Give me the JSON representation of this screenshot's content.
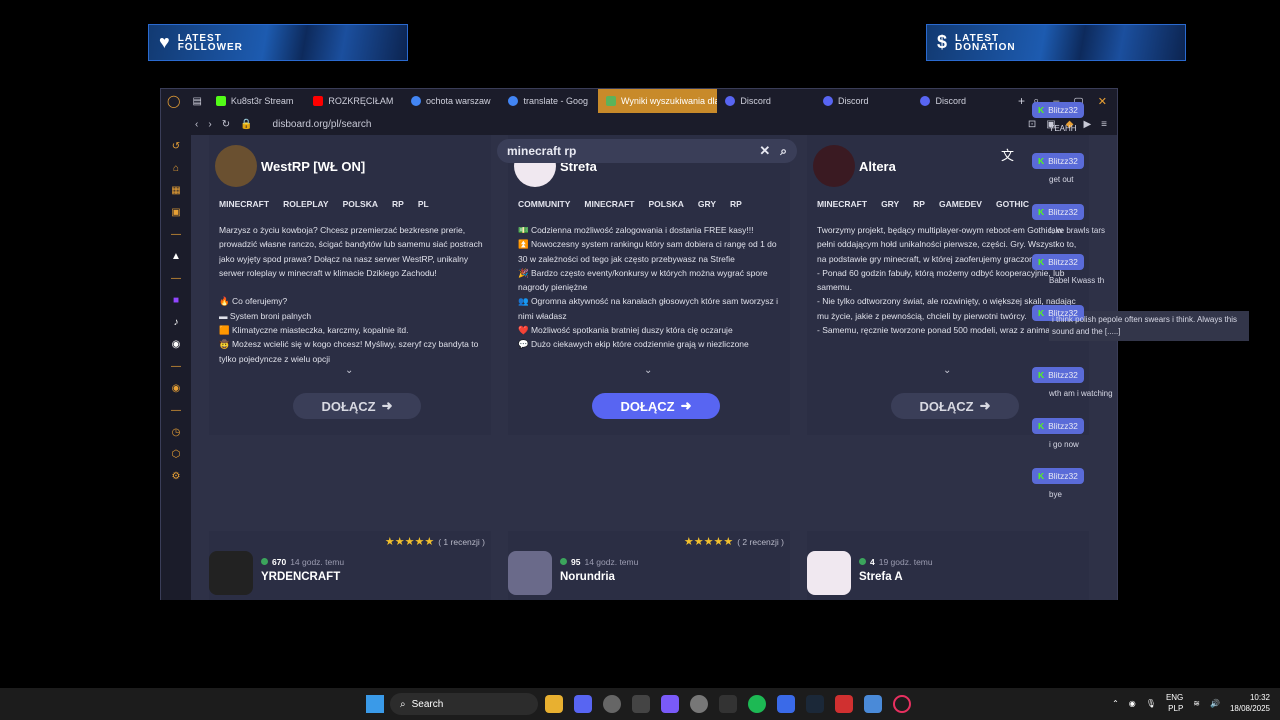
{
  "overlay": {
    "follower": {
      "line1": "LATEST",
      "line2": "FOLLOWER"
    },
    "donation": {
      "line1": "LATEST",
      "line2": "DONATION"
    }
  },
  "tabs": [
    {
      "label": "Ku8st3r Stream",
      "color": "#53fc18"
    },
    {
      "label": "ROZKRĘCIŁAM",
      "color": "#ff0000"
    },
    {
      "label": "ochota warszaw",
      "color": "#4285f4"
    },
    {
      "label": "translate - Goog",
      "color": "#4285f4"
    },
    {
      "label": "Wyniki wyszukiwania dla",
      "color": "#f0a030",
      "active": true
    },
    {
      "label": "Discord",
      "color": "#5865f2"
    },
    {
      "label": "Discord",
      "color": "#5865f2"
    },
    {
      "label": "Discord",
      "color": "#5865f2"
    }
  ],
  "address": {
    "url": "disboard.org/pl/search"
  },
  "search": {
    "query": "minecraft rp"
  },
  "servers": [
    {
      "name": "WestRP [WŁ ON]",
      "tags": [
        "MINECRAFT",
        "ROLEPLAY",
        "POLSKA",
        "RP",
        "PL"
      ],
      "desc": "Marzysz o życiu kowboja? Chcesz przemierzać bezkresne prerie, prowadzić własne ranczo, ścigać bandytów lub samemu siać postrach jako wyjęty spod prawa? Dołącz na nasz serwer WestRP, unikalny serwer roleplay w minecraft w klimacie Dzikiego Zachodu!\n\n🔥 Co oferujemy?\n▬ System broni palnych\n🟧 Klimatyczne miasteczka, karczmy, kopalnie itd.\n🤠 Możesz wcielić się w kogo chcesz! Myśliwy, szeryf czy bandyta to tylko pojedyncze z wielu opcji",
      "join": "DOŁĄCZ"
    },
    {
      "name": "Strefa",
      "tags": [
        "COMMUNITY",
        "MINECRAFT",
        "POLSKA",
        "GRY",
        "RP"
      ],
      "desc": "💵 Codzienna możliwość zalogowania i dostania FREE kasy!!!\n⏫ Nowoczesny system rankingu który sam dobiera ci rangę od 1 do 30 w zależności od tego jak często przebywasz na Strefie\n🎉 Bardzo często eventy/konkursy w których można wygrać spore nagrody pieniężne\n👥 Ogromna aktywność na kanałach głosowych które sam tworzysz i nimi władasz\n❤️ Możliwość spotkania bratniej duszy która cię oczaruje\n💬 Dużo ciekawych ekip które codziennie grają w niezliczone",
      "join": "DOŁĄCZ"
    },
    {
      "name": "Altera",
      "tags": [
        "MINECRAFT",
        "GRY",
        "RP",
        "GAMEDEV",
        "GOTHIC"
      ],
      "desc": "Tworzymy projekt, będący multiplayer-owym reboot-em Gothic, w pełni oddającym hołd unikalności pierwsze, części. Gry. Wszystko to, na podstawie gry minecraft, w której zaoferujemy graczom:\n- Ponad 60 godzin fabuły, którą możemy odbyć kooperacyjnie, lub samemu.\n- Nie tylko odtworzony świat, ale rozwinięty, o większej skali, nadając mu życie, jakie z pewnością, chcieli by pierwotni twórcy.\n- Samemu, ręcznie tworzone ponad 500 modeli, wraz z animacjami!",
      "join": "DOŁĄCZ"
    }
  ],
  "servers2": [
    {
      "name": "YRDENCRAFT",
      "count": "670",
      "time": "14 godz. temu",
      "stars": "★★★★★",
      "reviews": "( 1 recenzji )"
    },
    {
      "name": "Norundria",
      "count": "95",
      "time": "14 godz. temu",
      "stars": "★★★★★",
      "reviews": "( 2 recenzji )"
    },
    {
      "name": "Strefa A",
      "count": "4",
      "time": "19 godz. temu",
      "stars": "",
      "reviews": ""
    }
  ],
  "chat": [
    {
      "user": "Blitzz32",
      "text": "YEAHH"
    },
    {
      "user": "Blitzz32",
      "text": "get out"
    },
    {
      "user": "Blitzz32",
      "text": "fake brawls tars"
    },
    {
      "user": "Blitzz32",
      "text": "Babel Kwass th"
    },
    {
      "user": "Blitzz32",
      "text": "i think polish pepole often swears i think. Always this sound and the [.....]"
    },
    {
      "user": "Blitzz32",
      "text": "wth am i watching"
    },
    {
      "user": "Blitzz32",
      "text": "i go now"
    },
    {
      "user": "Blitzz32",
      "text": "bye"
    }
  ],
  "taskbar": {
    "search": "Search",
    "lang1": "ENG",
    "lang2": "PLP",
    "time": "10:32",
    "date": "18/08/2025"
  }
}
